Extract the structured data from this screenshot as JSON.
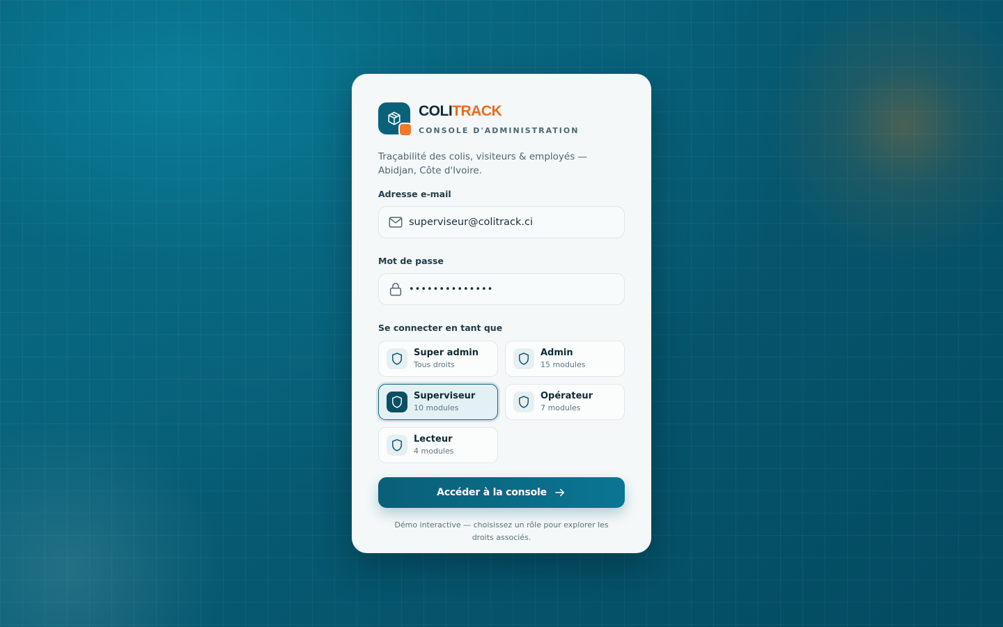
{
  "brand": {
    "name_part1": "COLI",
    "name_part2": "TRACK",
    "subtitle": "CONSOLE D'ADMINISTRATION",
    "tagline": "Traçabilité des colis, visiteurs & employés — Abidjan, Côte d'Ivoire."
  },
  "form": {
    "email_label": "Adresse e-mail",
    "email_value": "superviseur@colitrack.ci",
    "password_label": "Mot de passe",
    "password_value": "••••••••••••••",
    "role_label": "Se connecter en tant que",
    "selected_role": "Superviseur"
  },
  "roles": [
    {
      "name": "Super admin",
      "sub": "Tous droits",
      "icon": "shield-icon"
    },
    {
      "name": "Admin",
      "sub": "15 modules",
      "icon": "shield-icon"
    },
    {
      "name": "Superviseur",
      "sub": "10 modules",
      "icon": "shield-icon",
      "selected": true
    },
    {
      "name": "Opérateur",
      "sub": "7 modules",
      "icon": "shield-icon"
    },
    {
      "name": "Lecteur",
      "sub": "4 modules",
      "icon": "shield-icon"
    }
  ],
  "cta": {
    "label": "Accéder à la console",
    "icon": "arrow-right-icon"
  },
  "footer": "Démo interactive — choisissez un rôle pour explorer les droits associés.",
  "colors": {
    "primary": "#0a627a",
    "accent": "#ee6a1a",
    "card": "#f4f8f9"
  }
}
